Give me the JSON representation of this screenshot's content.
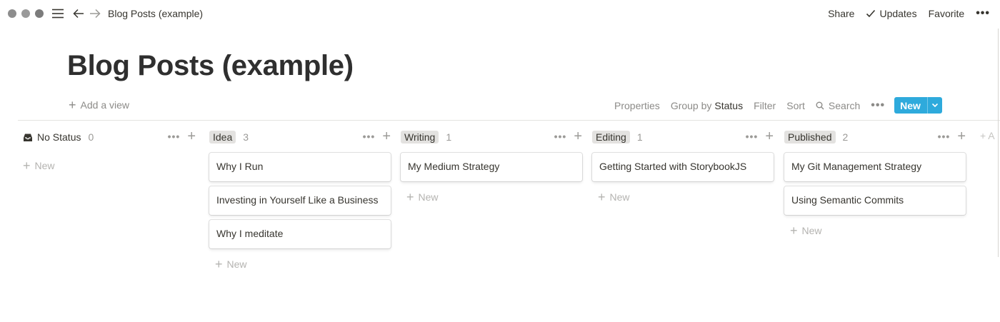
{
  "window": {
    "breadcrumb": "Blog Posts (example)"
  },
  "topbar": {
    "share": "Share",
    "updates": "Updates",
    "favorite": "Favorite",
    "more": "•••"
  },
  "page": {
    "title": "Blog Posts (example)"
  },
  "viewbar": {
    "add_view": "Add a view",
    "properties": "Properties",
    "group_by_label": "Group by",
    "group_by_value": "Status",
    "filter": "Filter",
    "sort": "Sort",
    "search": "Search",
    "more": "•••",
    "new": "New"
  },
  "board": {
    "new_label": "New",
    "columns": [
      {
        "name": "No Status",
        "count": "0",
        "cards": []
      },
      {
        "name": "Idea",
        "count": "3",
        "cards": [
          "Why I Run",
          "Investing in Yourself Like a Business",
          "Why I meditate"
        ]
      },
      {
        "name": "Writing",
        "count": "1",
        "cards": [
          "My Medium Strategy"
        ]
      },
      {
        "name": "Editing",
        "count": "1",
        "cards": [
          "Getting Started with StorybookJS"
        ]
      },
      {
        "name": "Published",
        "count": "2",
        "cards": [
          "My Git Management Strategy",
          "Using Semantic Commits"
        ]
      }
    ],
    "edge_add": "+ A"
  },
  "colors": {
    "accent": "#2eaadc",
    "tag_bg": "#e3e2e0",
    "text": "#37352f",
    "muted": "#9b9a97"
  },
  "icons": [
    "menu-icon",
    "back-arrow-icon",
    "forward-arrow-icon",
    "checkmark-icon",
    "search-icon",
    "chevron-down-icon",
    "inbox-icon",
    "plus-icon",
    "more-dots-icon"
  ]
}
